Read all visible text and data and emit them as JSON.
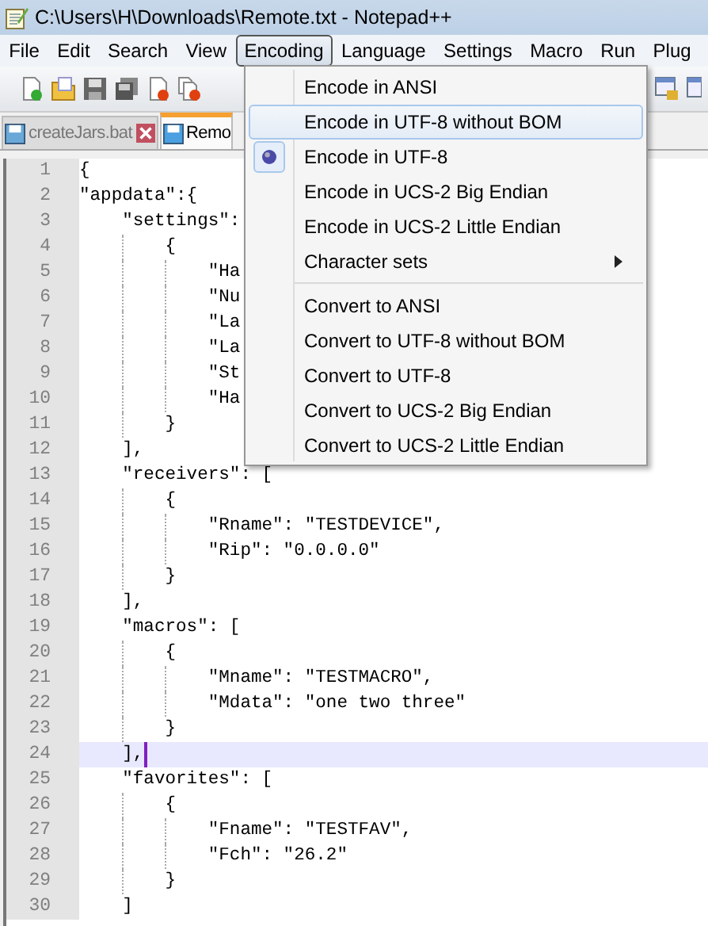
{
  "window": {
    "title": "C:\\Users\\H\\Downloads\\Remote.txt - Notepad++"
  },
  "menubar": [
    {
      "label": "File",
      "selected": false
    },
    {
      "label": "Edit",
      "selected": false
    },
    {
      "label": "Search",
      "selected": false
    },
    {
      "label": "View",
      "selected": false
    },
    {
      "label": "Encoding",
      "selected": true
    },
    {
      "label": "Language",
      "selected": false
    },
    {
      "label": "Settings",
      "selected": false
    },
    {
      "label": "Macro",
      "selected": false
    },
    {
      "label": "Run",
      "selected": false
    },
    {
      "label": "Plug",
      "selected": false
    }
  ],
  "tabs": [
    {
      "label": "createJars.bat",
      "selected": false
    },
    {
      "label": "Remo",
      "selected": true
    }
  ],
  "encoding_menu": [
    {
      "kind": "item",
      "label": "Encode in ANSI",
      "checked": false,
      "highlighted": false,
      "submenu": false
    },
    {
      "kind": "item",
      "label": "Encode in UTF-8 without BOM",
      "checked": false,
      "highlighted": true,
      "submenu": false
    },
    {
      "kind": "item",
      "label": "Encode in UTF-8",
      "checked": true,
      "highlighted": false,
      "submenu": false
    },
    {
      "kind": "item",
      "label": "Encode in UCS-2 Big Endian",
      "checked": false,
      "highlighted": false,
      "submenu": false
    },
    {
      "kind": "item",
      "label": "Encode in UCS-2 Little Endian",
      "checked": false,
      "highlighted": false,
      "submenu": false
    },
    {
      "kind": "item",
      "label": "Character sets",
      "checked": false,
      "highlighted": false,
      "submenu": true
    },
    {
      "kind": "separator"
    },
    {
      "kind": "item",
      "label": "Convert to ANSI",
      "checked": false,
      "highlighted": false,
      "submenu": false
    },
    {
      "kind": "item",
      "label": "Convert to UTF-8 without BOM",
      "checked": false,
      "highlighted": false,
      "submenu": false
    },
    {
      "kind": "item",
      "label": "Convert to UTF-8",
      "checked": false,
      "highlighted": false,
      "submenu": false
    },
    {
      "kind": "item",
      "label": "Convert to UCS-2 Big Endian",
      "checked": false,
      "highlighted": false,
      "submenu": false
    },
    {
      "kind": "item",
      "label": "Convert to UCS-2 Little Endian",
      "checked": false,
      "highlighted": false,
      "submenu": false
    }
  ],
  "editor": {
    "lines": [
      {
        "number": "1",
        "text": "{",
        "current": false
      },
      {
        "number": "2",
        "text": "\"appdata\":{",
        "current": false
      },
      {
        "number": "3",
        "text": "    \"settings\":",
        "current": false
      },
      {
        "number": "4",
        "text": "        {",
        "current": false
      },
      {
        "number": "5",
        "text": "            \"Ha",
        "current": false
      },
      {
        "number": "6",
        "text": "            \"Nu",
        "current": false
      },
      {
        "number": "7",
        "text": "            \"La",
        "current": false
      },
      {
        "number": "8",
        "text": "            \"La",
        "current": false
      },
      {
        "number": "9",
        "text": "            \"St",
        "current": false
      },
      {
        "number": "10",
        "text": "            \"Ha",
        "current": false
      },
      {
        "number": "11",
        "text": "        }",
        "current": false
      },
      {
        "number": "12",
        "text": "    ],",
        "current": false
      },
      {
        "number": "13",
        "text": "    \"receivers\": [",
        "current": false
      },
      {
        "number": "14",
        "text": "        {",
        "current": false
      },
      {
        "number": "15",
        "text": "            \"Rname\": \"TESTDEVICE\",",
        "current": false
      },
      {
        "number": "16",
        "text": "            \"Rip\": \"0.0.0.0\"",
        "current": false
      },
      {
        "number": "17",
        "text": "        }",
        "current": false
      },
      {
        "number": "18",
        "text": "    ],",
        "current": false
      },
      {
        "number": "19",
        "text": "    \"macros\": [",
        "current": false
      },
      {
        "number": "20",
        "text": "        {",
        "current": false
      },
      {
        "number": "21",
        "text": "            \"Mname\": \"TESTMACRO\",",
        "current": false
      },
      {
        "number": "22",
        "text": "            \"Mdata\": \"one two three\"",
        "current": false
      },
      {
        "number": "23",
        "text": "        }",
        "current": false
      },
      {
        "number": "24",
        "text": "    ],",
        "current": true
      },
      {
        "number": "25",
        "text": "    \"favorites\": [",
        "current": false
      },
      {
        "number": "26",
        "text": "        {",
        "current": false
      },
      {
        "number": "27",
        "text": "            \"Fname\": \"TESTFAV\",",
        "current": false
      },
      {
        "number": "28",
        "text": "            \"Fch\": \"26.2\"",
        "current": false
      },
      {
        "number": "29",
        "text": "        }",
        "current": false
      },
      {
        "number": "30",
        "text": "    ]",
        "current": false
      }
    ]
  }
}
